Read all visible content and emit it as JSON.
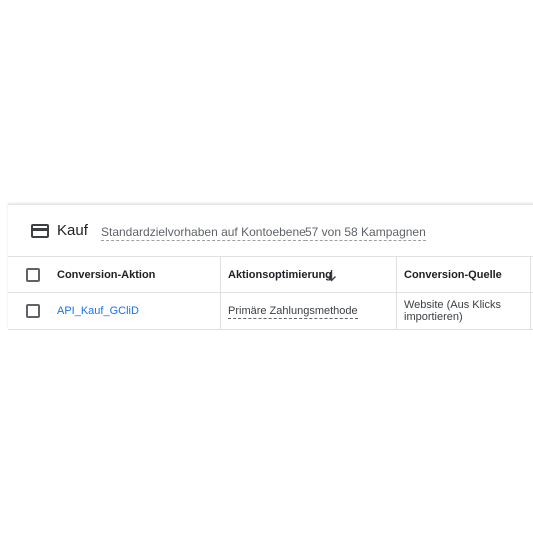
{
  "card": {
    "title": "Kauf",
    "icon": "credit-card-icon",
    "meta": [
      "Standardzielvorhaben auf Kontoebene",
      "57 von 58 Kampagnen"
    ]
  },
  "table": {
    "columns": [
      {
        "label": "Conversion-Aktion"
      },
      {
        "label": "Aktionsoptimierung",
        "sort": "descending",
        "sort_icon": "arrow-down-icon"
      },
      {
        "label": "Conversion-Quelle"
      }
    ],
    "rows": [
      {
        "conversion_action": "API_Kauf_GCliD",
        "optimization": "Primäre Zahlungsmethode",
        "source": "Website (Aus Klicks importieren)",
        "checked": false
      }
    ]
  },
  "colors": {
    "link": "#1a73e8",
    "text": "#202124",
    "muted": "#5f6368",
    "divider": "#e0e0e0"
  }
}
